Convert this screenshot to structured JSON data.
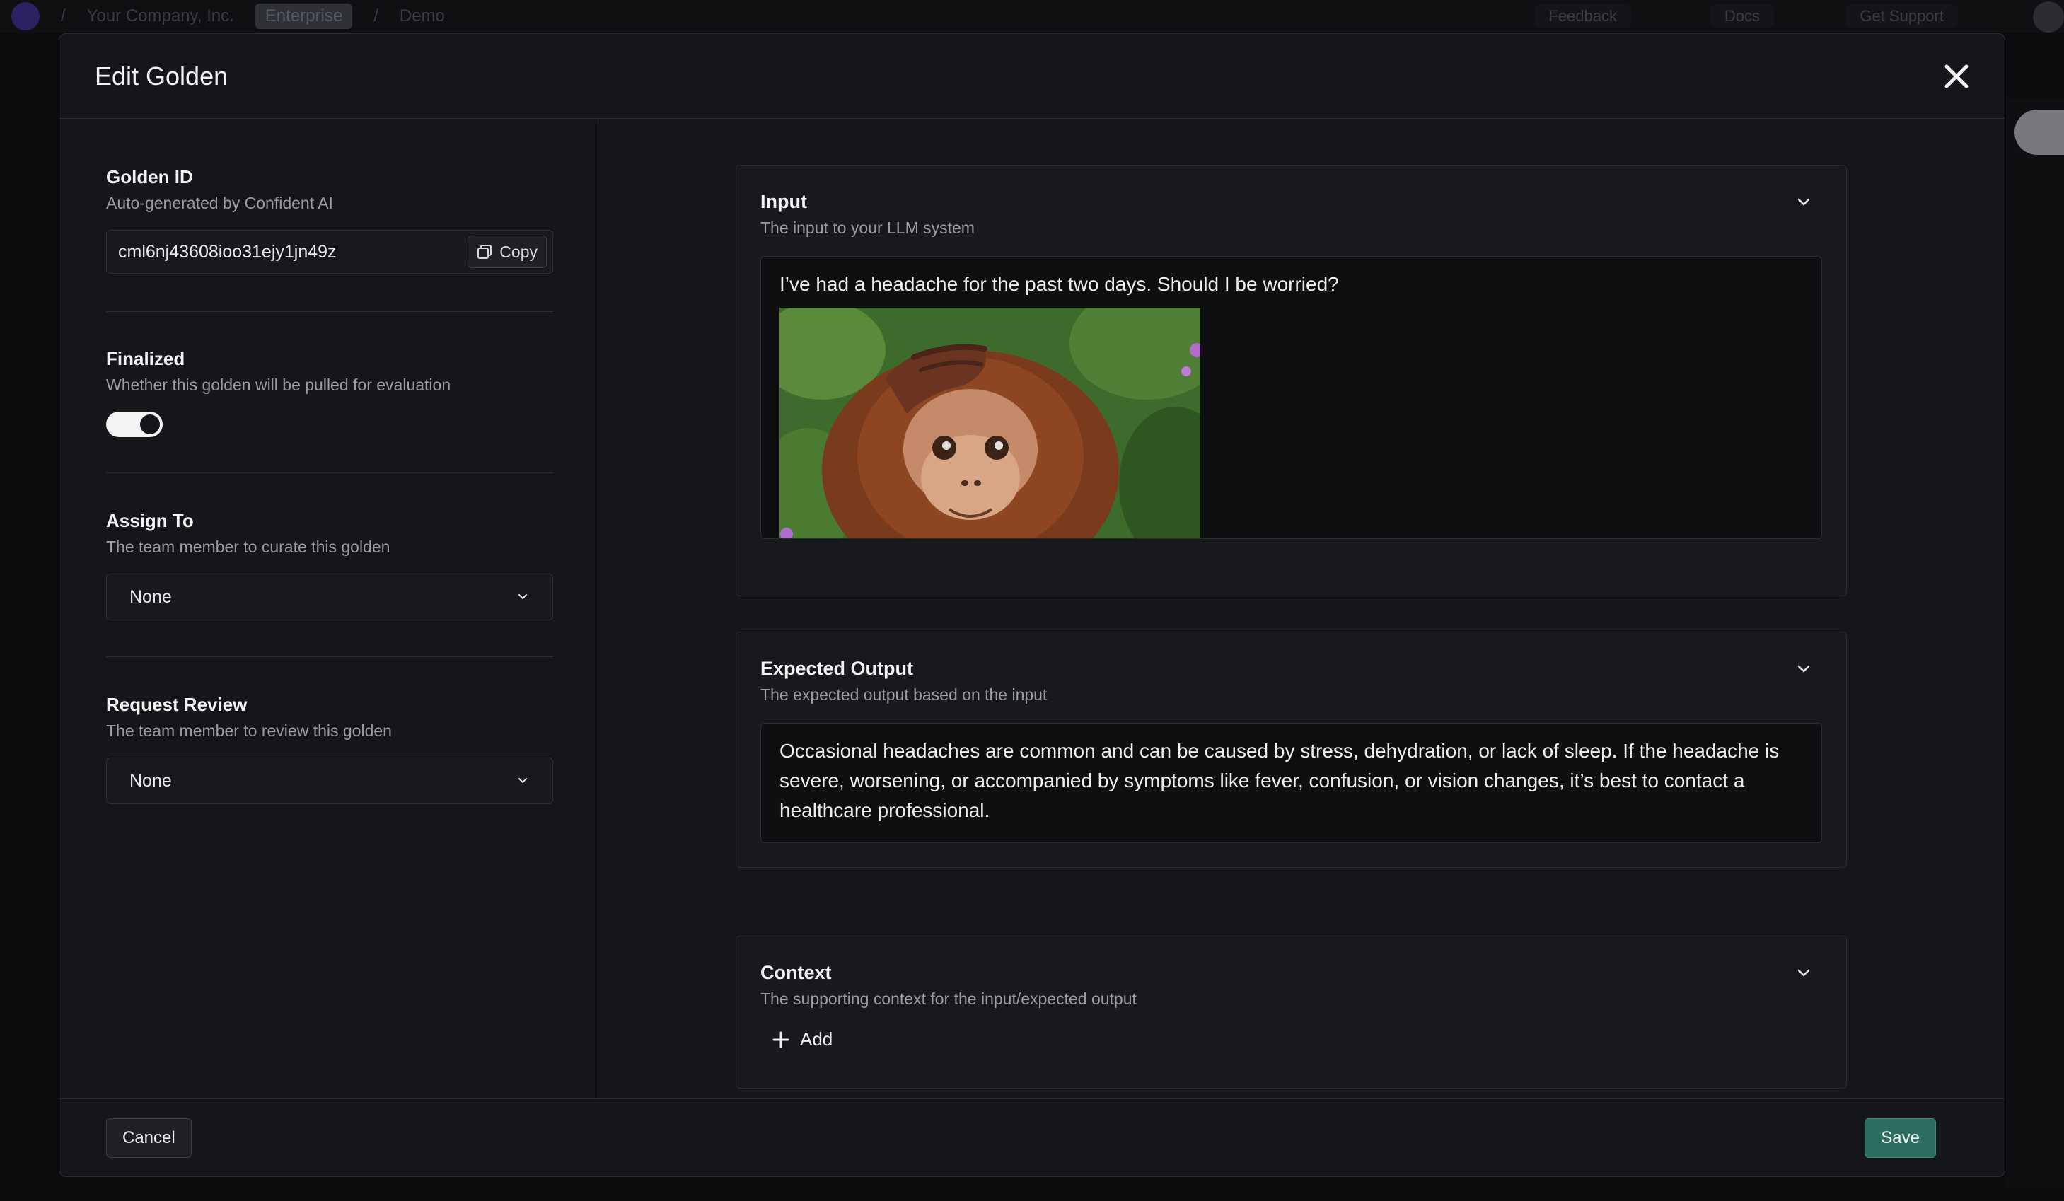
{
  "background": {
    "company": "Your Company, Inc.",
    "plan_badge": "Enterprise",
    "project": "Demo",
    "feedback": "Feedback",
    "docs": "Docs",
    "support": "Get Support"
  },
  "modal": {
    "title": "Edit Golden",
    "golden_id": {
      "title": "Golden ID",
      "description": "Auto-generated by Confident AI",
      "value": "cml6nj43608ioo31ejy1jn49z",
      "copy_label": "Copy"
    },
    "finalized": {
      "title": "Finalized",
      "description": "Whether this golden will be pulled for evaluation",
      "enabled": true
    },
    "assign_to": {
      "title": "Assign To",
      "description": "The team member to curate this golden",
      "value": "None"
    },
    "request_review": {
      "title": "Request Review",
      "description": "The team member to review this golden",
      "value": "None"
    },
    "input": {
      "title": "Input",
      "description": "The input to your LLM system",
      "text": "I’ve had a headache for the past two days. Should I be worried?",
      "image": "orangutan-photo"
    },
    "expected_output": {
      "title": "Expected Output",
      "description": "The expected output based on the input",
      "text": "Occasional headaches are common and can be caused by stress, dehydration, or lack of sleep. If the headache is severe, worsening, or accompanied by symptoms like fever, confusion, or vision changes, it’s best to contact a healthcare professional."
    },
    "context": {
      "title": "Context",
      "description": "The supporting context for the input/expected output",
      "add_label": "Add"
    },
    "footer": {
      "cancel_label": "Cancel",
      "save_label": "Save"
    }
  },
  "colors": {
    "save_button": "#2b6e60",
    "modal_bg": "#151619"
  }
}
